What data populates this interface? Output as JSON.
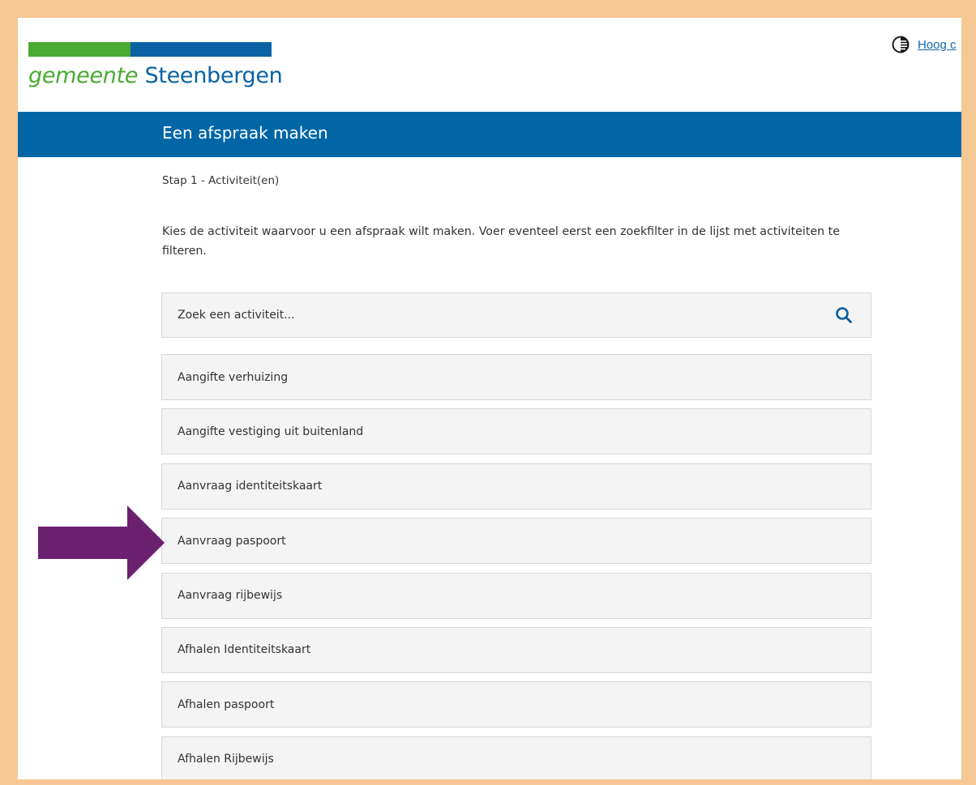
{
  "header": {
    "logo_prefix": "gemeente",
    "logo_name": "Steenbergen",
    "contrast_link": "Hoog c"
  },
  "banner": {
    "title": "Een afspraak maken"
  },
  "step": "Stap 1 - Activiteit(en)",
  "intro": "Kies de activiteit waarvoor u een afspraak wilt maken. Voer eventeel eerst een zoekfilter in de lijst met activiteiten te filteren.",
  "search": {
    "placeholder": "Zoek een activiteit...",
    "icon": "search-icon"
  },
  "activities": [
    "Aangifte verhuizing",
    "Aangifte vestiging uit buitenland",
    "Aanvraag identiteitskaart",
    "Aanvraag paspoort",
    "Aanvraag rijbewijs",
    "Afhalen Identiteitskaart",
    "Afhalen paspoort",
    "Afhalen Rijbewijs"
  ],
  "colors": {
    "border": "#f5c893",
    "brand_blue": "#0066a6",
    "brand_green": "#4aaa32",
    "arrow": "#6b2170"
  }
}
